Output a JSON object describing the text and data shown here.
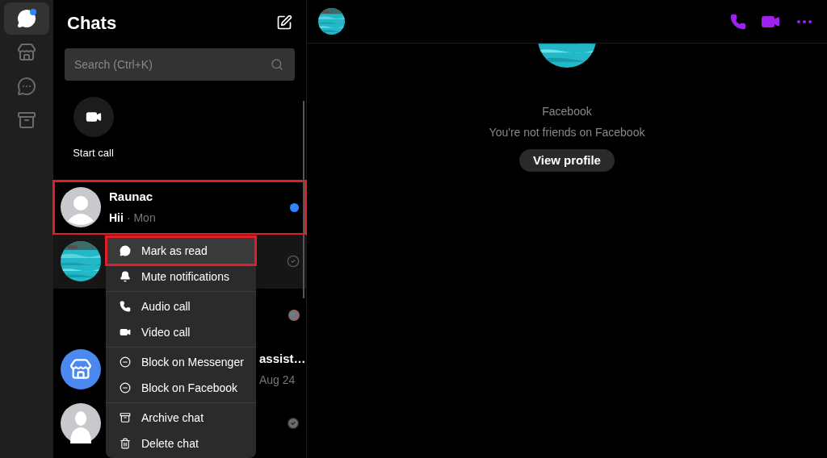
{
  "rail": [
    {
      "kind": "chats",
      "selected": true,
      "badge": true
    },
    {
      "kind": "marketplace",
      "selected": false,
      "badge": false
    },
    {
      "kind": "requests",
      "selected": false,
      "badge": false
    },
    {
      "kind": "archive",
      "selected": false,
      "badge": false
    }
  ],
  "list": {
    "title": "Chats",
    "search": {
      "placeholder": "Search (Ctrl+K)"
    },
    "start_call": "Start call",
    "chats": [
      {
        "avatar": {
          "kind": "person"
        },
        "name": "Raunac",
        "message": "Hii",
        "time": "· Mon",
        "unread": true,
        "highlighted": true,
        "hovered": false
      },
      {
        "hovered": true,
        "highlighted": false,
        "unread": false,
        "status": {
          "kind": "sent"
        }
      },
      {
        "hovered": false,
        "highlighted": false,
        "unread": false,
        "status": {
          "kind": "seen"
        }
      },
      {
        "avatar": {
          "kind": "store"
        },
        "name": "assist…",
        "time": "Aug 24",
        "hovered": false,
        "highlighted": false,
        "unread": false
      },
      {
        "avatar": {
          "kind": "silhouette"
        },
        "hovered": false,
        "highlighted": false,
        "unread": false,
        "status": {
          "kind": "delivered"
        }
      }
    ]
  },
  "menu": [
    {
      "kind": "read",
      "label": "Mark as read",
      "highlighted": true,
      "divider_after": false
    },
    {
      "kind": "mute",
      "label": "Mute notifications",
      "highlighted": false,
      "divider_after": true
    },
    {
      "kind": "audio",
      "label": "Audio call",
      "highlighted": false,
      "divider_after": false
    },
    {
      "kind": "video",
      "label": "Video call",
      "highlighted": false,
      "divider_after": true
    },
    {
      "kind": "block",
      "label": "Block on Messenger",
      "highlighted": false,
      "divider_after": false
    },
    {
      "kind": "block",
      "label": "Block on Facebook",
      "highlighted": false,
      "divider_after": true
    },
    {
      "kind": "archive",
      "label": "Archive chat",
      "highlighted": false,
      "divider_after": false
    },
    {
      "kind": "delete",
      "label": "Delete chat",
      "highlighted": false,
      "divider_after": false
    }
  ],
  "conversation": {
    "subtitle": "Facebook",
    "note": "You're not friends on Facebook",
    "button": "View profile"
  }
}
